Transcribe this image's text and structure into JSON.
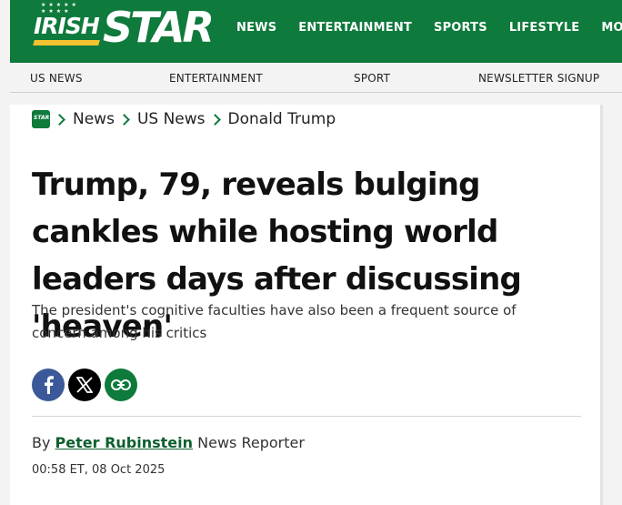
{
  "brand": {
    "logo_text_1": "IRISH",
    "logo_text_2": "STAR",
    "mini_logo": "STAR"
  },
  "top_nav": [
    "NEWS",
    "ENTERTAINMENT",
    "SPORTS",
    "LIFESTYLE",
    "MORE"
  ],
  "sub_nav": [
    "US NEWS",
    "ENTERTAINMENT",
    "SPORT",
    "NEWSLETTER SIGNUP"
  ],
  "breadcrumb": [
    "News",
    "US News",
    "Donald Trump"
  ],
  "article": {
    "headline": "Trump, 79, reveals bulging cankles while hosting world leaders days after discussing 'heaven'",
    "standfirst": "The president's cognitive faculties have also been a frequent source of concern among his critics",
    "by_prefix": "By",
    "author": "Peter Rubinstein",
    "author_role": "News Reporter",
    "date": "00:58 ET, 08 Oct 2025"
  },
  "share_icons": [
    "facebook-icon",
    "x-icon",
    "link-icon"
  ],
  "colors": {
    "brand_green": "#0e7a3c",
    "facebook": "#3b5998",
    "logo_gold": "#f2c230"
  }
}
